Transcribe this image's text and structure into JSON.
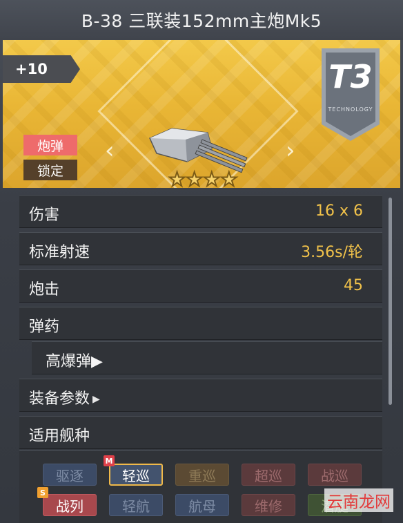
{
  "title": "B-38 三联装152mm主炮Mk5",
  "banner": {
    "level": "+10",
    "tier": "T3",
    "tier_sub": "TECHNOLOGY",
    "badge_shell": "炮弹",
    "badge_lock": "锁定",
    "stars": "★★★★"
  },
  "stats": [
    {
      "label": "伤害",
      "value": "16 x 6"
    },
    {
      "label": "标准射速",
      "value": "3.56s/轮"
    },
    {
      "label": "炮击",
      "value": "45"
    },
    {
      "label": "弹药",
      "value": ""
    }
  ],
  "ammo_type": "高爆弹",
  "equipment_params": "装备参数",
  "applicable_ships": "适用舰种",
  "ship_tags_row1": [
    "驱逐",
    "轻巡",
    "重巡",
    "超巡",
    "战巡"
  ],
  "ship_tags_row2": [
    "战列",
    "轻航",
    "航母",
    "维修",
    "潜艇"
  ],
  "tag_markers": {
    "m": "M",
    "s": "S"
  },
  "watermark": "云南龙网",
  "colors": {
    "accent": "#f1c24a",
    "banner": "#e9b635",
    "shell_badge": "#ee6b6b"
  }
}
